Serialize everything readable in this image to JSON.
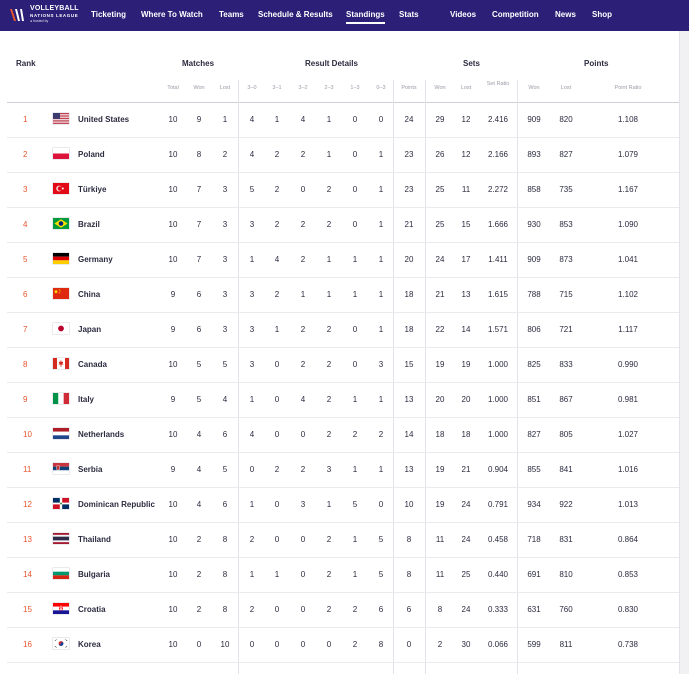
{
  "nav": {
    "logo": {
      "line1": "VOLLEYBALL",
      "line2": "NATIONS LEAGUE",
      "line3": "● hosted by"
    },
    "items": [
      "Ticketing",
      "Where To Watch",
      "Teams",
      "Schedule & Results",
      "Standings",
      "Stats",
      "Videos",
      "Competition",
      "News",
      "Shop"
    ],
    "active": "Standings"
  },
  "header": {
    "rank": "Rank",
    "matches": "Matches",
    "result_details": "Result Details",
    "sets": "Sets",
    "points": "Points",
    "sub": {
      "total": "Total",
      "won": "Won",
      "lost": "Lost",
      "r30": "3–0",
      "r31": "3–1",
      "r32": "3–2",
      "r23": "2–3",
      "r13": "1–3",
      "r03": "0–3",
      "pts": "Points",
      "sets_won": "Won",
      "sets_lost": "Lost",
      "set_ratio": "Set Ratio",
      "points_won": "Won",
      "points_lost": "Lost",
      "point_ratio": "Point Ratio"
    }
  },
  "teams": [
    {
      "rank": "1",
      "flag": "us-flag-icon",
      "name": "United States",
      "total": "10",
      "won": "9",
      "lost": "1",
      "r30": "4",
      "r31": "1",
      "r32": "4",
      "r23": "1",
      "r13": "0",
      "r03": "0",
      "pts": "24",
      "sw": "29",
      "sl": "12",
      "sr": "2.416",
      "pw": "909",
      "pl": "820",
      "pr": "1.108"
    },
    {
      "rank": "2",
      "flag": "pl-flag-icon",
      "name": "Poland",
      "total": "10",
      "won": "8",
      "lost": "2",
      "r30": "4",
      "r31": "2",
      "r32": "2",
      "r23": "1",
      "r13": "0",
      "r03": "1",
      "pts": "23",
      "sw": "26",
      "sl": "12",
      "sr": "2.166",
      "pw": "893",
      "pl": "827",
      "pr": "1.079"
    },
    {
      "rank": "3",
      "flag": "tr-flag-icon",
      "name": "Türkiye",
      "total": "10",
      "won": "7",
      "lost": "3",
      "r30": "5",
      "r31": "2",
      "r32": "0",
      "r23": "2",
      "r13": "0",
      "r03": "1",
      "pts": "23",
      "sw": "25",
      "sl": "11",
      "sr": "2.272",
      "pw": "858",
      "pl": "735",
      "pr": "1.167"
    },
    {
      "rank": "4",
      "flag": "br-flag-icon",
      "name": "Brazil",
      "total": "10",
      "won": "7",
      "lost": "3",
      "r30": "3",
      "r31": "2",
      "r32": "2",
      "r23": "2",
      "r13": "0",
      "r03": "1",
      "pts": "21",
      "sw": "25",
      "sl": "15",
      "sr": "1.666",
      "pw": "930",
      "pl": "853",
      "pr": "1.090"
    },
    {
      "rank": "5",
      "flag": "de-flag-icon",
      "name": "Germany",
      "total": "10",
      "won": "7",
      "lost": "3",
      "r30": "1",
      "r31": "4",
      "r32": "2",
      "r23": "1",
      "r13": "1",
      "r03": "1",
      "pts": "20",
      "sw": "24",
      "sl": "17",
      "sr": "1.411",
      "pw": "909",
      "pl": "873",
      "pr": "1.041"
    },
    {
      "rank": "6",
      "flag": "cn-flag-icon",
      "name": "China",
      "total": "9",
      "won": "6",
      "lost": "3",
      "r30": "3",
      "r31": "2",
      "r32": "1",
      "r23": "1",
      "r13": "1",
      "r03": "1",
      "pts": "18",
      "sw": "21",
      "sl": "13",
      "sr": "1.615",
      "pw": "788",
      "pl": "715",
      "pr": "1.102"
    },
    {
      "rank": "7",
      "flag": "jp-flag-icon",
      "name": "Japan",
      "total": "9",
      "won": "6",
      "lost": "3",
      "r30": "3",
      "r31": "1",
      "r32": "2",
      "r23": "2",
      "r13": "0",
      "r03": "1",
      "pts": "18",
      "sw": "22",
      "sl": "14",
      "sr": "1.571",
      "pw": "806",
      "pl": "721",
      "pr": "1.117"
    },
    {
      "rank": "8",
      "flag": "ca-flag-icon",
      "name": "Canada",
      "total": "10",
      "won": "5",
      "lost": "5",
      "r30": "3",
      "r31": "0",
      "r32": "2",
      "r23": "2",
      "r13": "0",
      "r03": "3",
      "pts": "15",
      "sw": "19",
      "sl": "19",
      "sr": "1.000",
      "pw": "825",
      "pl": "833",
      "pr": "0.990"
    },
    {
      "rank": "9",
      "flag": "it-flag-icon",
      "name": "Italy",
      "total": "9",
      "won": "5",
      "lost": "4",
      "r30": "1",
      "r31": "0",
      "r32": "4",
      "r23": "2",
      "r13": "1",
      "r03": "1",
      "pts": "13",
      "sw": "20",
      "sl": "20",
      "sr": "1.000",
      "pw": "851",
      "pl": "867",
      "pr": "0.981"
    },
    {
      "rank": "10",
      "flag": "nl-flag-icon",
      "name": "Netherlands",
      "total": "10",
      "won": "4",
      "lost": "6",
      "r30": "4",
      "r31": "0",
      "r32": "0",
      "r23": "2",
      "r13": "2",
      "r03": "2",
      "pts": "14",
      "sw": "18",
      "sl": "18",
      "sr": "1.000",
      "pw": "827",
      "pl": "805",
      "pr": "1.027"
    },
    {
      "rank": "11",
      "flag": "rs-flag-icon",
      "name": "Serbia",
      "total": "9",
      "won": "4",
      "lost": "5",
      "r30": "0",
      "r31": "2",
      "r32": "2",
      "r23": "3",
      "r13": "1",
      "r03": "1",
      "pts": "13",
      "sw": "19",
      "sl": "21",
      "sr": "0.904",
      "pw": "855",
      "pl": "841",
      "pr": "1.016"
    },
    {
      "rank": "12",
      "flag": "do-flag-icon",
      "name": "Dominican Republic",
      "total": "10",
      "won": "4",
      "lost": "6",
      "r30": "1",
      "r31": "0",
      "r32": "3",
      "r23": "1",
      "r13": "5",
      "r03": "0",
      "pts": "10",
      "sw": "19",
      "sl": "24",
      "sr": "0.791",
      "pw": "934",
      "pl": "922",
      "pr": "1.013"
    },
    {
      "rank": "13",
      "flag": "th-flag-icon",
      "name": "Thailand",
      "total": "10",
      "won": "2",
      "lost": "8",
      "r30": "2",
      "r31": "0",
      "r32": "0",
      "r23": "2",
      "r13": "1",
      "r03": "5",
      "pts": "8",
      "sw": "11",
      "sl": "24",
      "sr": "0.458",
      "pw": "718",
      "pl": "831",
      "pr": "0.864"
    },
    {
      "rank": "14",
      "flag": "bg-flag-icon",
      "name": "Bulgaria",
      "total": "10",
      "won": "2",
      "lost": "8",
      "r30": "1",
      "r31": "1",
      "r32": "0",
      "r23": "2",
      "r13": "1",
      "r03": "5",
      "pts": "8",
      "sw": "11",
      "sl": "25",
      "sr": "0.440",
      "pw": "691",
      "pl": "810",
      "pr": "0.853"
    },
    {
      "rank": "15",
      "flag": "hr-flag-icon",
      "name": "Croatia",
      "total": "10",
      "won": "2",
      "lost": "8",
      "r30": "2",
      "r31": "0",
      "r32": "0",
      "r23": "2",
      "r13": "2",
      "r03": "6",
      "pts": "6",
      "sw": "8",
      "sl": "24",
      "sr": "0.333",
      "pw": "631",
      "pl": "760",
      "pr": "0.830"
    },
    {
      "rank": "16",
      "flag": "kr-flag-icon",
      "name": "Korea",
      "total": "10",
      "won": "0",
      "lost": "10",
      "r30": "0",
      "r31": "0",
      "r32": "0",
      "r23": "0",
      "r13": "2",
      "r03": "8",
      "pts": "0",
      "sw": "2",
      "sl": "30",
      "sr": "0.066",
      "pw": "599",
      "pl": "811",
      "pr": "0.738"
    }
  ],
  "colors": {
    "nav_bg": "#2b1f77",
    "rank_accent": "#e8542c",
    "text": "#2b2b40",
    "subheader": "#9a9aa8"
  }
}
